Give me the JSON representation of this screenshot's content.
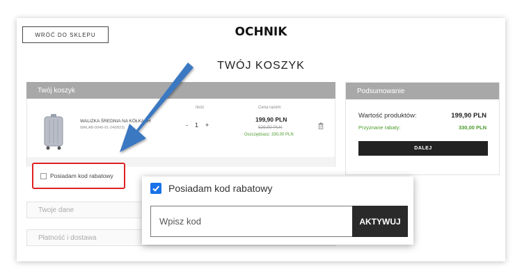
{
  "header": {
    "back_label": "WRÓĆ DO SKLEPU",
    "logo": "OCHNIK",
    "page_title": "TWÓJ KOSZYK"
  },
  "cart": {
    "panel_title": "Twój koszyk",
    "col_qty": "Ilość",
    "col_price": "Cena razem",
    "item": {
      "name": "WALIZKA ŚREDNIA NA KÓŁKACH",
      "sku": "WALAB-0040-91-24(W23)",
      "qty_minus": "-",
      "qty": "1",
      "qty_plus": "+",
      "price": "199,90 PLN",
      "old_price": "529,90 PLN",
      "saving": "Oszczędzasz: 330,00 PLN"
    },
    "discount_label": "Posiadam kod rabatowy"
  },
  "accordions": {
    "your_data": "Twoje dane",
    "payment": "Płatność i dostawa"
  },
  "summary": {
    "title": "Podsumowanie",
    "products_label": "Wartość produktów:",
    "products_value": "199,90 PLN",
    "discounts_label": "Przyznane rabaty:",
    "discounts_value": "330,00 PLN",
    "next_label": "DALEJ"
  },
  "popup": {
    "checkbox_label": "Posiadam kod rabatowy",
    "checked": true,
    "input_placeholder": "Wpisz kod",
    "activate_label": "AKTYWUJ"
  },
  "colors": {
    "panel_header": "#a8a8a8",
    "highlight": "#e02020",
    "arrow": "#3a78c2",
    "checkbox": "#1a73e8",
    "discount_green": "#4a9a2a"
  },
  "icons": [
    "suitcase-icon",
    "trash-icon",
    "checkmark-icon",
    "arrow-annotation"
  ]
}
